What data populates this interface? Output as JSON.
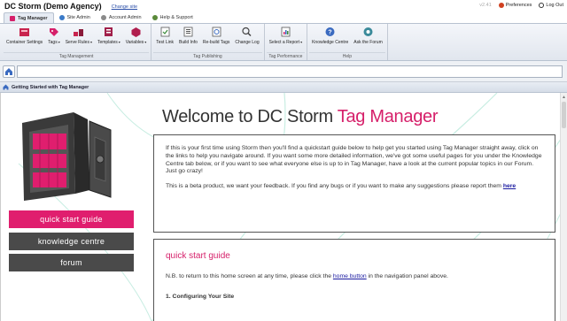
{
  "app": {
    "title": "DC Storm (Demo Agency)",
    "change_site": "Change site"
  },
  "top_right": {
    "version": "v2.41",
    "preferences": "Preferences",
    "logout": "Log Out"
  },
  "tabs": [
    {
      "label": "Tag Manager",
      "active": true
    },
    {
      "label": "Site Admin",
      "active": false
    },
    {
      "label": "Account Admin",
      "active": false
    },
    {
      "label": "Help & Support",
      "active": false
    }
  ],
  "ribbon": {
    "tag_management": {
      "label": "Tag Management",
      "buttons": [
        "Container Settings",
        "Tags",
        "Serve Rules",
        "Templates",
        "Variables"
      ]
    },
    "tag_publishing": {
      "label": "Tag Publishing",
      "buttons": [
        "Test Link",
        "Build Info",
        "Re-build Tags",
        "Change Log"
      ]
    },
    "tag_performance": {
      "label": "Tag Performance",
      "buttons": [
        "Select a Report"
      ]
    },
    "help": {
      "label": "Help",
      "buttons": [
        "Knowledge Centre",
        "Ask the Forum"
      ]
    }
  },
  "address_bar": {
    "value": ""
  },
  "panel": {
    "title": "Getting Started with Tag Manager"
  },
  "welcome": {
    "prefix": "Welcome to DC Storm ",
    "highlight": "Tag Manager"
  },
  "intro": {
    "para1": "If this is your first time using Storm then you'll find a quickstart guide below to help get you started using Tag Manager straight away, click on the links to help you navigate around. If you want some more detailed information, we've got some useful pages for you under the Knowledge Centre tab below, or if you want to see what everyone else is up to in Tag Manager, have a look at the current popular topics in our Forum. Just go crazy!",
    "para2": "This is a beta product, we want your feedback. If you find any bugs or if you want to make any suggestions please report them ",
    "here_link": "here"
  },
  "side_buttons": {
    "quick_start": "quick start guide",
    "knowledge": "knowledge centre",
    "forum": "forum"
  },
  "guide": {
    "heading": "quick start guide",
    "note_prefix": "N.B. to return to this home screen at any time, please click the ",
    "home_link": "home button",
    "note_suffix": " in the navigation panel above.",
    "step1": "1. Configuring Your Site"
  },
  "colors": {
    "accent": "#e01e6e",
    "dark_button": "#4a4a4a",
    "link": "#1a1aa0"
  }
}
